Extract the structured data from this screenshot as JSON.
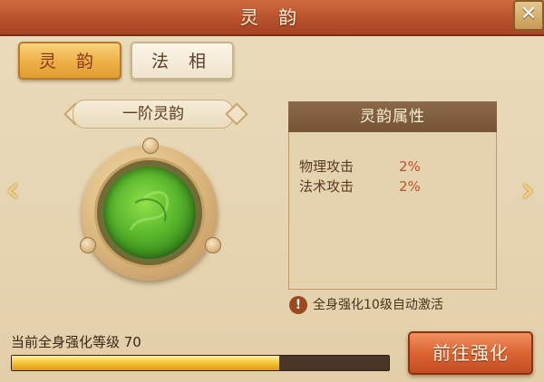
{
  "window": {
    "title": "灵 韵",
    "close_symbol": "✕"
  },
  "tabs": [
    {
      "label": "灵 韵",
      "active": true
    },
    {
      "label": "法 相",
      "active": false
    }
  ],
  "left_panel": {
    "level_label": "一阶灵韵",
    "emblem_icon": "green-dragon-orb-icon",
    "prev_symbol": "‹",
    "next_symbol": "›"
  },
  "attributes": {
    "header": "灵韵属性",
    "rows": [
      {
        "name": "物理攻击",
        "value": "2%"
      },
      {
        "name": "法术攻击",
        "value": "2%"
      }
    ]
  },
  "note": {
    "icon_symbol": "!",
    "text": "全身强化10级自动激活"
  },
  "footer": {
    "level_text": "当前全身强化等级 70",
    "progress_fraction": 0.71,
    "go_button_label": "前往强化"
  },
  "colors": {
    "accent_orange": "#dc6432",
    "value_red": "#c4502a",
    "progress_gold": "#f7c232"
  }
}
